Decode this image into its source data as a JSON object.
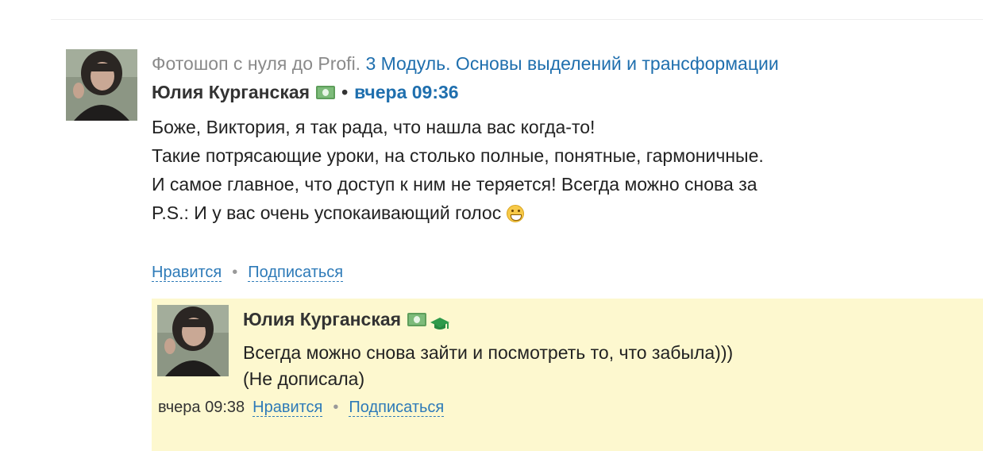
{
  "comment": {
    "course": "Фотошоп с нуля до Profi.",
    "module": "3 Модуль. Основы выделений и трансформации",
    "author": "Юлия Курганская",
    "separator": "•",
    "time": "вчера 09:36",
    "lines": [
      "Боже, Виктория, я так рада, что нашла вас когда-то!",
      "Такие потрясающие уроки, на столько полные, понятные, гармоничные.",
      "И самое главное, что доступ к ним не теряется! Всегда можно снова за",
      "P.S.: И у вас очень успокаивающий голос"
    ],
    "actions": {
      "like": "Нравится",
      "separator": "•",
      "subscribe": "Подписаться"
    }
  },
  "reply": {
    "author": "Юлия Курганская",
    "lines": [
      "Всегда можно снова зайти и посмотреть то, что забыла)))",
      "(Не дописала)"
    ],
    "time": "вчера 09:38",
    "actions": {
      "like": "Нравится",
      "separator": "•",
      "subscribe": "Подписаться"
    }
  },
  "icons": {
    "author_badge": "money-icon",
    "reply_badges": [
      "money-icon",
      "graduation-cap-icon"
    ],
    "emoji": "grinning-face-icon"
  },
  "colors": {
    "link": "#1f6fae",
    "reply_background": "#fdf8cf",
    "money_badge": "#7dbb7a",
    "graduation_cap": "#2e9a4a"
  }
}
